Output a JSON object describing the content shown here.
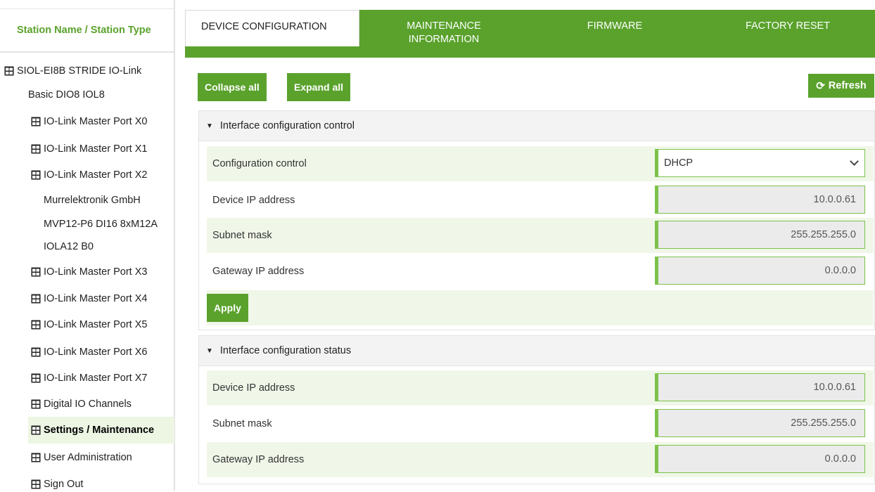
{
  "sidebar": {
    "header": "Station Name / Station Type",
    "items": [
      {
        "label": "SIOL-EI8B STRIDE IO-Link",
        "icon": "grid-icon"
      },
      {
        "label": "Basic DIO8 IOL8",
        "icon": ""
      },
      {
        "label": "IO-Link Master Port X0",
        "icon": "grid-icon"
      },
      {
        "label": "IO-Link Master Port X1",
        "icon": "grid-icon"
      },
      {
        "label": "IO-Link Master Port X2",
        "icon": "grid-icon"
      },
      {
        "label": "Murrelektronik GmbH",
        "icon": ""
      },
      {
        "label": "MVP12-P6 DI16 8xM12A",
        "icon": ""
      },
      {
        "label": "IOLA12 B0",
        "icon": ""
      },
      {
        "label": "IO-Link Master Port X3",
        "icon": "grid-icon"
      },
      {
        "label": "IO-Link Master Port X4",
        "icon": "grid-icon"
      },
      {
        "label": "IO-Link Master Port X5",
        "icon": "grid-icon"
      },
      {
        "label": "IO-Link Master Port X6",
        "icon": "grid-icon"
      },
      {
        "label": "IO-Link Master Port X7",
        "icon": "grid-icon"
      },
      {
        "label": "Digital IO Channels",
        "icon": "grid-icon"
      },
      {
        "label": "Settings / Maintenance",
        "icon": "grid-icon"
      },
      {
        "label": "User Administration",
        "icon": "grid-icon"
      },
      {
        "label": "Sign Out",
        "icon": "grid-icon"
      }
    ]
  },
  "tabs": [
    {
      "label": "DEVICE CONFIGURATION"
    },
    {
      "label": "MAINTENANCE\nINFORMATION"
    },
    {
      "label": "FIRMWARE"
    },
    {
      "label": "FACTORY RESET"
    }
  ],
  "toolbar": {
    "collapse_label": "Collapse all",
    "expand_label": "Expand all",
    "refresh_label": "Refresh"
  },
  "control_section": {
    "title": "Interface configuration control",
    "rows": [
      {
        "label": "Configuration control",
        "value": "DHCP"
      },
      {
        "label": "Device IP address",
        "value": "10.0.0.61"
      },
      {
        "label": "Subnet mask",
        "value": "255.255.255.0"
      },
      {
        "label": "Gateway IP address",
        "value": "0.0.0.0"
      }
    ],
    "apply_label": "Apply"
  },
  "status_section": {
    "title": "Interface configuration status",
    "rows": [
      {
        "label": "Device IP address",
        "value": "10.0.0.61"
      },
      {
        "label": "Subnet mask",
        "value": "255.255.255.0"
      },
      {
        "label": "Gateway IP address",
        "value": "0.0.0.0"
      }
    ]
  },
  "colors": {
    "accent": "#5aa22c",
    "row_alt": "#f0f7e9",
    "field_border": "#7cc24a"
  }
}
